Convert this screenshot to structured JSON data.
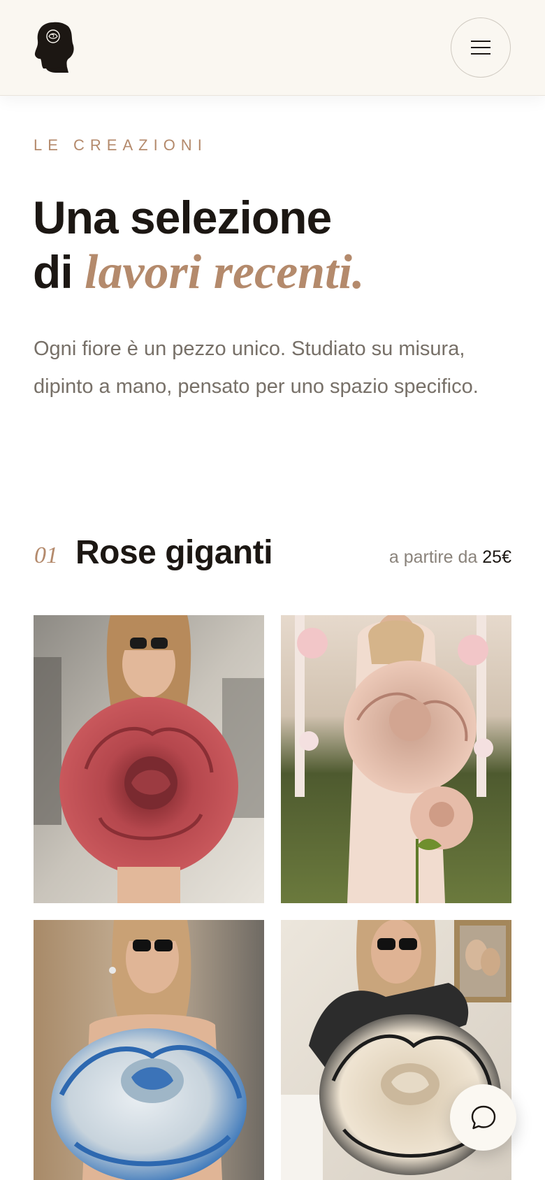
{
  "header": {
    "logo_icon": "woman-silhouette-logo-icon",
    "menu_icon": "hamburger-menu-icon"
  },
  "hero": {
    "eyebrow": "LE CREAZIONI",
    "headline_line1": "Una selezione",
    "headline_line2_prefix": "di ",
    "headline_accent": "lavori recenti.",
    "intro": "Ogni fiore è un pezzo unico. Studiato su misura, dipinto a mano, pensato per uno spazio specifico."
  },
  "section": {
    "number": "01",
    "title": "Rose giganti",
    "price_prefix": "a partire da ",
    "price_value": "25€"
  },
  "gallery": [
    {
      "name": "red-rose-street"
    },
    {
      "name": "pink-rose-wedding"
    },
    {
      "name": "blue-silver-rose-street"
    },
    {
      "name": "cream-black-rose-interior"
    }
  ],
  "chat": {
    "icon": "chat-bubble-icon"
  },
  "colors": {
    "accent": "#b48a6c",
    "text": "#1c1713",
    "muted": "#777068",
    "header_bg": "#faf7f1"
  }
}
